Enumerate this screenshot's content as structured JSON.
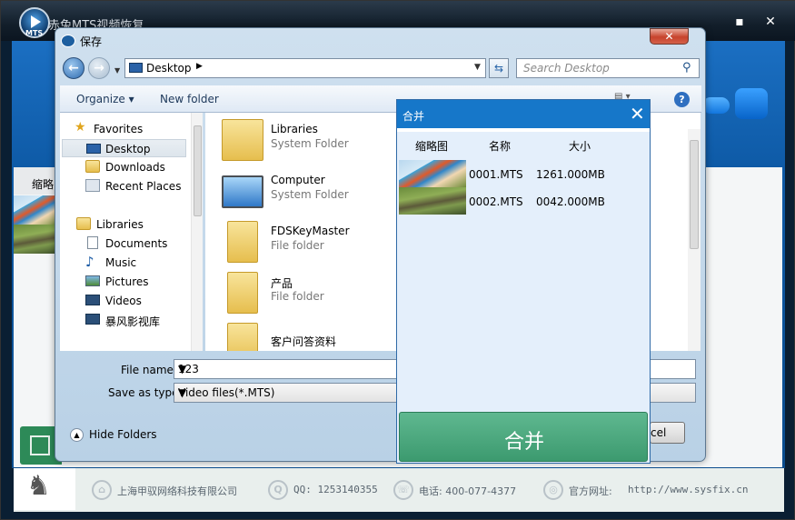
{
  "app": {
    "title": "赤兔MTS视频恢复",
    "logo_text": "MTS",
    "controls": [
      "▪",
      "✕"
    ],
    "minimize": "▪",
    "close": "✕",
    "thumb_header": "缩略",
    "footer": {
      "company": "上海甲驭网络科技有限公司",
      "qq": "QQ: 1253140355",
      "phone": "电话: 400-077-4377",
      "site_label": "官方网址:",
      "site_url": "http://www.sysfix.cn"
    }
  },
  "save_dialog": {
    "title": "保存",
    "address": "Desktop",
    "search_placeholder": "Search Desktop",
    "toolbar": {
      "organize": "Organize",
      "new_folder": "New folder",
      "help": "?"
    },
    "nav": {
      "favorites_header": "Favorites",
      "favorites": [
        "Desktop",
        "Downloads",
        "Recent Places"
      ],
      "selected": "Desktop",
      "libraries_header": "Libraries",
      "libraries": [
        "Documents",
        "Music",
        "Pictures",
        "Videos",
        "暴风影视库"
      ]
    },
    "files": [
      {
        "name": "Libraries",
        "type": "System Folder",
        "icon": "libraries-icon"
      },
      {
        "name": "Computer",
        "type": "System Folder",
        "icon": "computer-icon"
      },
      {
        "name": "FDSKeyMaster",
        "type": "File folder",
        "icon": "folder-icon"
      },
      {
        "name": "产品",
        "type": "File folder",
        "icon": "folder-icon"
      },
      {
        "name": "客户问答资料",
        "type": "",
        "icon": "folder-icon"
      }
    ],
    "file_name_label": "File name:",
    "file_name_value": "123",
    "save_type_label": "Save as type:",
    "save_type_value": "Video files(*.MTS)",
    "hide_folders": "Hide Folders",
    "cancel_partial": "cel"
  },
  "merge_dialog": {
    "title": "合并",
    "columns": [
      "缩略图",
      "名称",
      "大小"
    ],
    "rows": [
      {
        "name": "0001.MTS",
        "size": "1261.000MB"
      },
      {
        "name": "0002.MTS",
        "size": "0042.000MB"
      }
    ],
    "merge_button": "合并"
  }
}
